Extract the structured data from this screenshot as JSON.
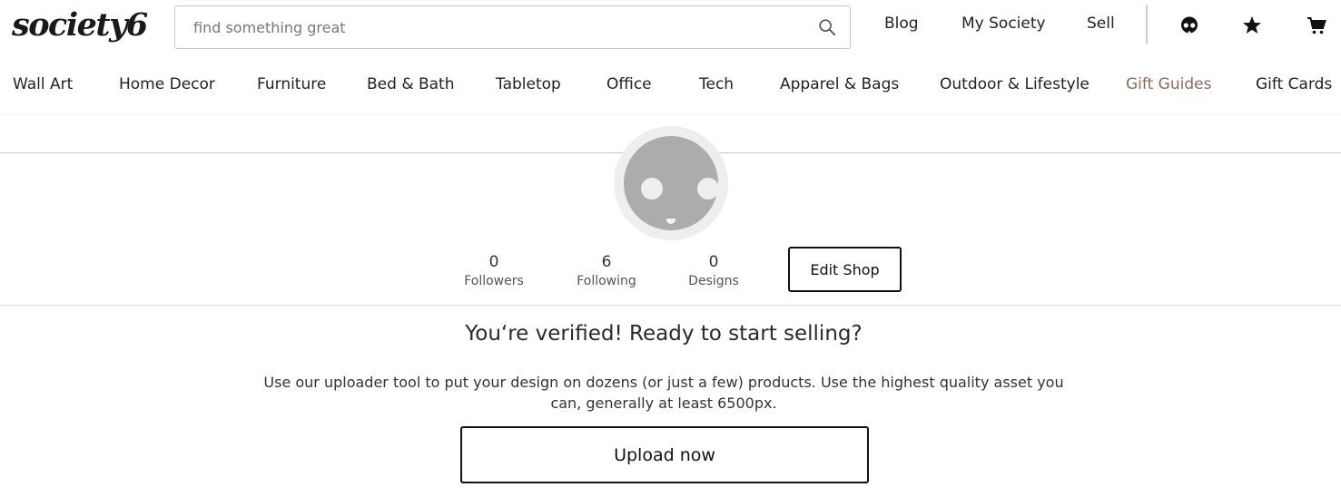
{
  "header": {
    "logo": "society6",
    "search": {
      "placeholder": "find something great",
      "value": ""
    },
    "links": [
      "Blog",
      "My Society",
      "Sell"
    ],
    "icons": [
      "skull-icon",
      "star-icon",
      "cart-icon"
    ]
  },
  "categories": [
    "Wall Art",
    "Home Decor",
    "Furniture",
    "Bed & Bath",
    "Tabletop",
    "Office",
    "Tech",
    "Apparel & Bags",
    "Outdoor & Lifestyle",
    "Gift Guides",
    "Gift Cards"
  ],
  "accent_color": "#8c6a5c",
  "profile": {
    "stats": [
      {
        "value": "0",
        "label": "Followers"
      },
      {
        "value": "6",
        "label": "Following"
      },
      {
        "value": "0",
        "label": "Designs"
      }
    ],
    "edit_button": "Edit Shop"
  },
  "verified": {
    "title": "You‘re verified! Ready to start selling?",
    "description": "Use our uploader tool to put your design on dozens (or just a few) products. Use the highest quality asset you can, generally at least 6500px.",
    "button": "Upload now"
  }
}
